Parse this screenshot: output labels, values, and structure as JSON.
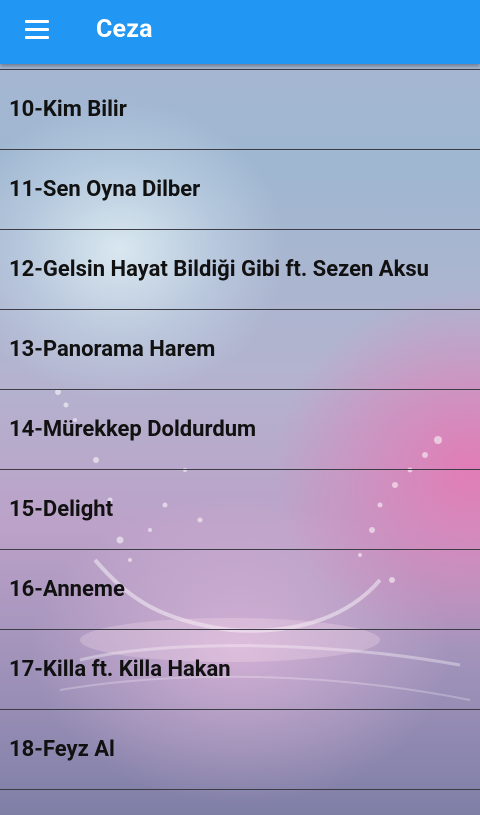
{
  "app_bar": {
    "title": "Ceza",
    "menu_icon": "menu-icon",
    "color": "#2196f3"
  },
  "songs": [
    "10-Kim Bilir",
    "11-Sen Oyna Dilber",
    "12-Gelsin Hayat Bildiği Gibi ft. Sezen Aksu",
    "13-Panorama Harem",
    "14-Mürekkep Doldurdum",
    "15-Delight",
    "16-Anneme",
    "17-Killa ft. Killa Hakan",
    "18-Feyz Al"
  ]
}
